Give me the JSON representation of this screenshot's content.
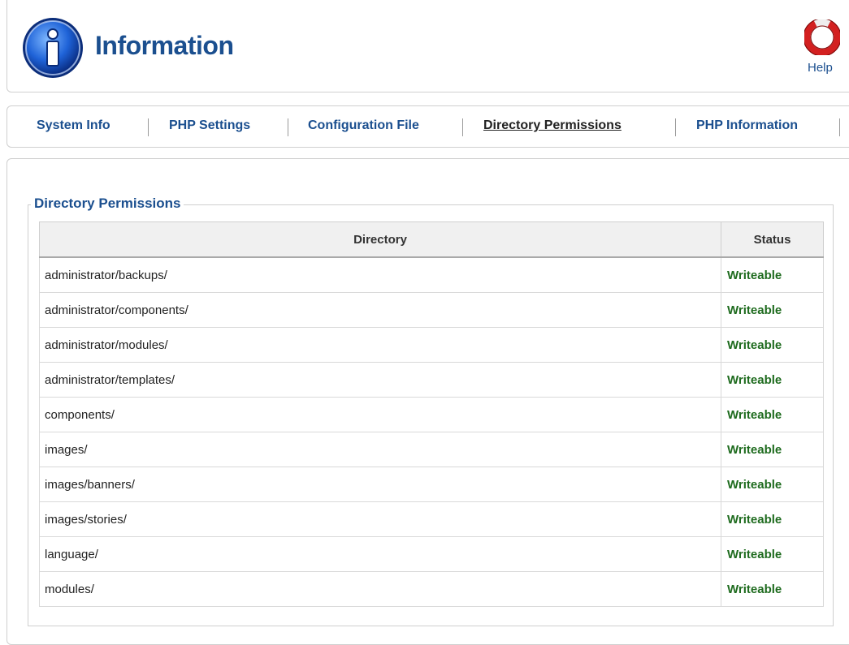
{
  "header": {
    "title": "Information",
    "help_label": "Help",
    "icon": "info-icon",
    "help_icon": "lifebuoy-icon"
  },
  "tabs": [
    {
      "label": "System Info",
      "active": false
    },
    {
      "label": "PHP Settings",
      "active": false
    },
    {
      "label": "Configuration File",
      "active": false
    },
    {
      "label": "Directory Permissions",
      "active": true
    },
    {
      "label": "PHP Information",
      "active": false
    }
  ],
  "section": {
    "legend": "Directory Permissions",
    "columns": [
      "Directory",
      "Status"
    ],
    "rows": [
      {
        "directory": "administrator/backups/",
        "status": "Writeable"
      },
      {
        "directory": "administrator/components/",
        "status": "Writeable"
      },
      {
        "directory": "administrator/modules/",
        "status": "Writeable"
      },
      {
        "directory": "administrator/templates/",
        "status": "Writeable"
      },
      {
        "directory": "components/",
        "status": "Writeable"
      },
      {
        "directory": "images/",
        "status": "Writeable"
      },
      {
        "directory": "images/banners/",
        "status": "Writeable"
      },
      {
        "directory": "images/stories/",
        "status": "Writeable"
      },
      {
        "directory": "language/",
        "status": "Writeable"
      },
      {
        "directory": "modules/",
        "status": "Writeable"
      }
    ]
  },
  "colors": {
    "title_blue": "#1b4f8f",
    "status_green": "#1e6b1e",
    "help_red": "#d32020"
  }
}
